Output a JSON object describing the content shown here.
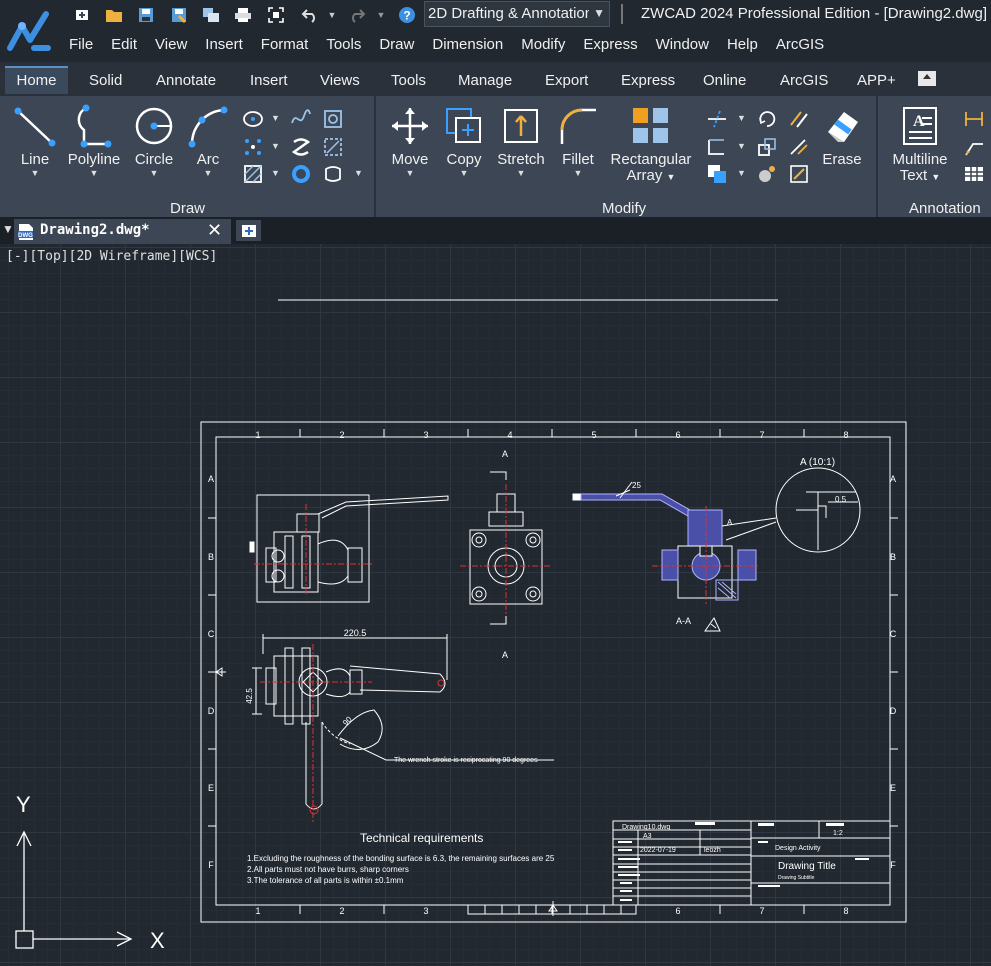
{
  "app": {
    "title": "ZWCAD 2024 Professional Edition - [Drawing2.dwg]",
    "workspace": "2D Drafting & Annotation"
  },
  "menu": [
    "File",
    "Edit",
    "View",
    "Insert",
    "Format",
    "Tools",
    "Draw",
    "Dimension",
    "Modify",
    "Express",
    "Window",
    "Help",
    "ArcGIS"
  ],
  "ribbon_tabs": [
    "Home",
    "Solid",
    "Annotate",
    "Insert",
    "Views",
    "Tools",
    "Manage",
    "Export",
    "Express",
    "Online",
    "ArcGIS",
    "APP+"
  ],
  "ribbon": {
    "draw": {
      "label": "Draw",
      "line": "Line",
      "polyline": "Polyline",
      "circle": "Circle",
      "arc": "Arc"
    },
    "modify": {
      "label": "Modify",
      "move": "Move",
      "copy": "Copy",
      "stretch": "Stretch",
      "fillet": "Fillet",
      "array1": "Rectangular",
      "array2": "Array",
      "erase": "Erase"
    },
    "annotation": {
      "label": "Annotation",
      "mtext1": "Multiline",
      "mtext2": "Text"
    }
  },
  "document": {
    "tab": "Drawing2.dwg*"
  },
  "viewport": {
    "controls": "[-][Top][2D Wireframe][WCS]"
  },
  "ucs": {
    "x": "X",
    "y": "Y"
  },
  "sheet": {
    "cols": [
      "1",
      "2",
      "3",
      "4",
      "5",
      "6",
      "7",
      "8"
    ],
    "rows": [
      "A",
      "B",
      "C",
      "D",
      "E",
      "F"
    ],
    "section_mark": "A",
    "section_label": "A-A",
    "detail_label": "A (10:1)",
    "detail_dim": "0.5",
    "dim_angle": "25",
    "dim_width": "220.5",
    "dim_height": "42.5",
    "dim_arc": "90",
    "wrench_note": "The wrench stroke is reciprocating 90 degrees",
    "tech_title": "Technical requirements",
    "tech_reqs": [
      "1.Excluding the roughness of the bonding surface is 6.3, the remaining surfaces are 25",
      "2.All parts must not have burrs, sharp corners",
      "3.The tolerance of all parts is within ±0.1mm"
    ],
    "title_block": {
      "file": "Drawing10.dwg",
      "size": "A3",
      "date": "2022-07-19",
      "author": "leozh",
      "scale": "1:2",
      "activity": "Design Activity",
      "title": "Drawing Title",
      "subtitle": "Drawing Subtitle"
    }
  }
}
